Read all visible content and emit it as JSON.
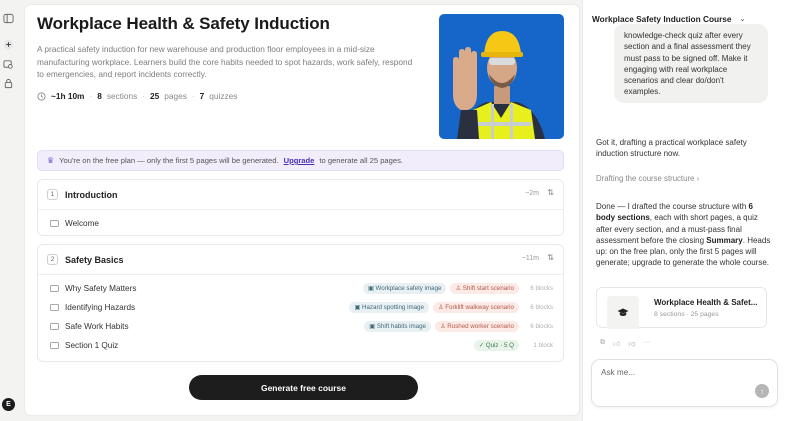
{
  "rail": {
    "avatar_letter": "E"
  },
  "course": {
    "title": "Workplace Health & Safety Induction",
    "description": "A practical safety induction for new warehouse and production floor employees in a mid-size manufacturing workplace. Learners build the core habits needed to spot hazards, work safely, respond to emergencies, and report incidents correctly.",
    "duration": "~1h 10m",
    "sections_count": "8",
    "sections_label": "sections",
    "pages_count": "25",
    "pages_label": "pages",
    "quizzes_count": "7",
    "quizzes_label": "quizzes"
  },
  "plan_banner": {
    "text": "You're on the free plan — only the first 5 pages will be generated.",
    "link": "Upgrade",
    "suffix": "to generate all 25 pages."
  },
  "sections": [
    {
      "number": "1",
      "title": "Introduction",
      "duration": "~2m",
      "pages": [
        {
          "label": "Welcome"
        }
      ]
    },
    {
      "number": "2",
      "title": "Safety Basics",
      "duration": "~11m",
      "pages": [
        {
          "label": "Why Safety Matters",
          "image_tag": "Workplace safety image",
          "scenario_tag": "Shift start scenario",
          "blocks": "6 blocks"
        },
        {
          "label": "Identifying Hazards",
          "image_tag": "Hazard spotting image",
          "scenario_tag": "Forklift walkway scenario",
          "blocks": "6 blocks"
        },
        {
          "label": "Safe Work Habits",
          "image_tag": "Shift habits image",
          "scenario_tag": "Rushed worker scenario",
          "blocks": "6 blocks"
        },
        {
          "label": "Section 1 Quiz",
          "quiz_tag": "Quiz · 5 Q",
          "blocks": "1 block"
        }
      ]
    }
  ],
  "generate_button": "Generate free course",
  "chat": {
    "title": "Workplace Safety Induction Course",
    "user_message": "knowledge-check quiz after every section and a final assessment they must pass to be signed off. Make it engaging with real workplace scenarios and clear do/don't examples.",
    "reply_1": "Got it, drafting a practical workplace safety induction structure now.",
    "drafting_label": "Drafting the course structure",
    "reply_2_a": "Done — I drafted the course structure with ",
    "reply_2_b": "6 body sections",
    "reply_2_c": ", each with short pages, a quiz after every section, and a must-pass final assessment before the closing ",
    "reply_2_d": "Summary",
    "reply_2_e": ". Heads up: on the free plan, only the first 5 pages will generate; upgrade to generate the whole course.",
    "course_card_title": "Workplace Health & Safet...",
    "course_card_sub": "8 sections · 25 pages",
    "input_placeholder": "Ask me..."
  }
}
